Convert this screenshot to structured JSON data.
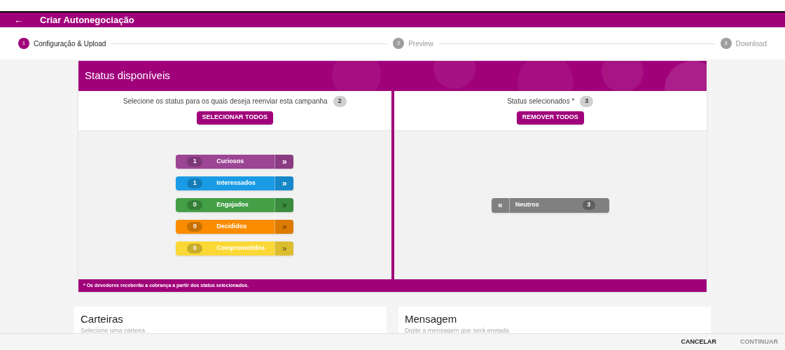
{
  "app_bar": {
    "back_icon": "←",
    "title": "Criar Autonegociação"
  },
  "steps": [
    {
      "number": "1",
      "label": "Configuração & Upload",
      "selected": true
    },
    {
      "number": "2",
      "label": "Preview",
      "selected": false
    },
    {
      "number": "3",
      "label": "Download",
      "selected": false
    }
  ],
  "status_card": {
    "title": "Status disponíveis",
    "available": {
      "prompt": "Selecione os status para os quais deseja reenviar esta campanha",
      "count": "2",
      "button": "SELECIONAR TODOS",
      "items": [
        {
          "count": "1",
          "label": "Curiosos",
          "color": "#9c4594",
          "action": "»",
          "disabled": false
        },
        {
          "count": "1",
          "label": "Interessados",
          "color": "#1a9be6",
          "action": "»",
          "disabled": false
        },
        {
          "count": "0",
          "label": "Engajados",
          "color": "#43a047",
          "action": "»",
          "disabled": true
        },
        {
          "count": "0",
          "label": "Decididos",
          "color": "#fb8c00",
          "action": "»",
          "disabled": true
        },
        {
          "count": "0",
          "label": "Comprometidos",
          "color": "#fbd835",
          "action": "»",
          "disabled": true
        }
      ]
    },
    "selected": {
      "prompt": "Status selecionados *",
      "count": "3",
      "button": "REMOVER TODOS",
      "items": [
        {
          "count": "3",
          "label": "Neutros",
          "color": "#808080",
          "action": "«",
          "disabled": false
        }
      ]
    },
    "footnote": "* Os devedores receberão a cobrança a partir dos status selecionados."
  },
  "sections": [
    {
      "title": "Carteiras",
      "hint": "Selecione uma carteira"
    },
    {
      "title": "Mensagem",
      "hint": "Digite a mensagem que será enviada"
    }
  ],
  "actions": [
    {
      "label": "CANCELAR",
      "disabled": false
    },
    {
      "label": "CONTINUAR",
      "disabled": true
    }
  ]
}
